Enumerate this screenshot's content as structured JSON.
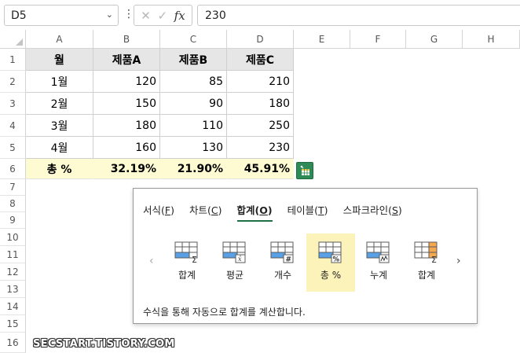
{
  "formula_bar": {
    "name_box": "D5",
    "name_box_chevron": "chevron-down-icon",
    "formula": "230",
    "fx_label": "fx"
  },
  "columns": [
    "A",
    "B",
    "C",
    "D",
    "E",
    "F",
    "G",
    "H"
  ],
  "rows": [
    "1",
    "2",
    "3",
    "4",
    "5",
    "6",
    "7",
    "8",
    "9",
    "10",
    "11",
    "12",
    "13",
    "14",
    "15",
    "16"
  ],
  "table": {
    "headers": [
      "월",
      "제품A",
      "제품B",
      "제품C"
    ],
    "rows": [
      [
        "1월",
        "120",
        "85",
        "210"
      ],
      [
        "2월",
        "150",
        "90",
        "180"
      ],
      [
        "3월",
        "180",
        "110",
        "250"
      ],
      [
        "4월",
        "160",
        "130",
        "230"
      ]
    ],
    "total_row": [
      "총 %",
      "32.19%",
      "21.90%",
      "45.91%"
    ]
  },
  "quick_analysis": {
    "button_icon": "quick-analysis-icon",
    "tabs": [
      {
        "label": "서식",
        "key": "F"
      },
      {
        "label": "차트",
        "key": "C"
      },
      {
        "label": "합계",
        "key": "O"
      },
      {
        "label": "테이블",
        "key": "T"
      },
      {
        "label": "스파크라인",
        "key": "S"
      }
    ],
    "active_tab": "합계",
    "tiles": [
      {
        "label": "합계",
        "icon": "sum-icon"
      },
      {
        "label": "평균",
        "icon": "average-icon"
      },
      {
        "label": "개수",
        "icon": "count-icon"
      },
      {
        "label": "총 %",
        "icon": "percent-total-icon"
      },
      {
        "label": "누계",
        "icon": "running-total-icon"
      },
      {
        "label": "합계",
        "icon": "sum-right-icon"
      }
    ],
    "selected_tile": "총 %",
    "description": "수식을 통해 자동으로 합계를 계산합니다."
  },
  "watermark": "SECSTART.TISTORY.COM",
  "colors": {
    "header_fill": "#e7e6e6",
    "highlight_fill": "#fefbd2",
    "excel_green": "#1e7145",
    "selected_tile": "#fbf3ba"
  }
}
